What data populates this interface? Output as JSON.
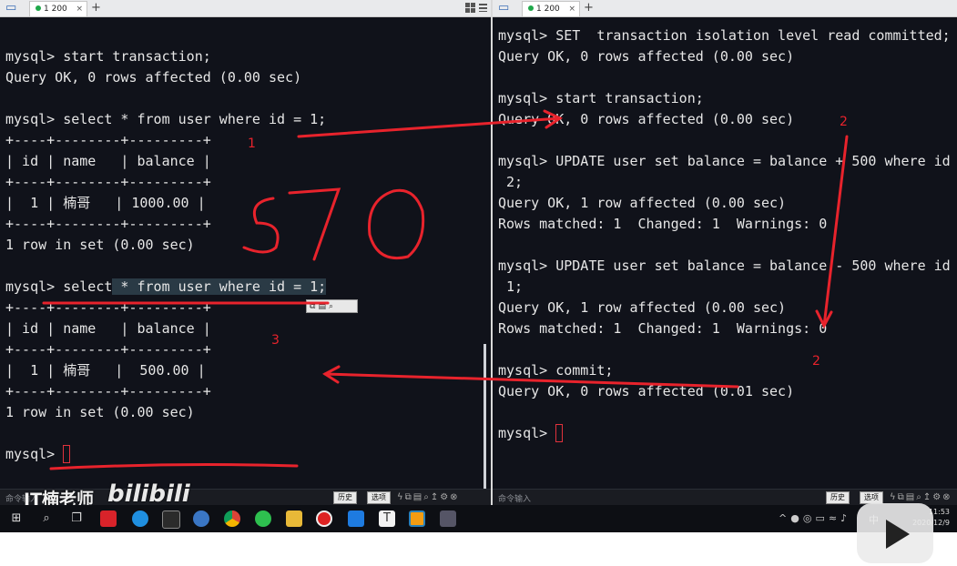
{
  "left_pane": {
    "tab_label": "1 200",
    "lines": [
      "mysql> start transaction;",
      "Query OK, 0 rows affected (0.00 sec)",
      "",
      "mysql> select * from user where id = 1;",
      "+----+--------+---------+",
      "| id | name   | balance |",
      "+----+--------+---------+",
      "|  1 | 楠哥   | 1000.00 |",
      "+----+--------+---------+",
      "1 row in set (0.00 sec)",
      "",
      "mysql> select * from user where id = 1;",
      "+----+--------+---------+",
      "| id | name   | balance |",
      "+----+--------+---------+",
      "|  1 | 楠哥   |  500.00 |",
      "+----+--------+---------+",
      "1 row in set (0.00 sec)",
      "",
      "mysql> "
    ],
    "status": {
      "cmd_label": "命令输入",
      "history_btn": "历史",
      "options_btn": "选项"
    }
  },
  "right_pane": {
    "tab_label": "1 200",
    "lines": [
      "mysql> SET  transaction isolation level read committed;",
      "Query OK, 0 rows affected (0.00 sec)",
      "",
      "mysql> start transaction;",
      "Query OK, 0 rows affected (0.00 sec)",
      "",
      "mysql> UPDATE user set balance = balance + 500 where id =",
      " 2;",
      "Query OK, 1 row affected (0.00 sec)",
      "Rows matched: 1  Changed: 1  Warnings: 0",
      "",
      "mysql> UPDATE user set balance = balance - 500 where id =",
      " 1;",
      "Query OK, 1 row affected (0.00 sec)",
      "Rows matched: 1  Changed: 1  Warnings: 0",
      "",
      "mysql> commit;",
      "Query OK, 0 rows affected (0.01 sec)",
      "",
      "mysql> "
    ],
    "status": {
      "cmd_label": "命令输入",
      "history_btn": "历史",
      "options_btn": "选项"
    }
  },
  "annotations": {
    "n1": "1",
    "n2a": "2",
    "n2b": "2",
    "n3": "3",
    "scribble": "570"
  },
  "watermark": {
    "author": "IT楠老师",
    "site": "bilibili"
  },
  "taskbar": {
    "ime": "中",
    "time": "11:53",
    "date": "2020/12/9"
  },
  "colors": {
    "annotation": "#e8232c",
    "terminal_bg": "#10121a",
    "terminal_text": "#e6e6e6"
  }
}
